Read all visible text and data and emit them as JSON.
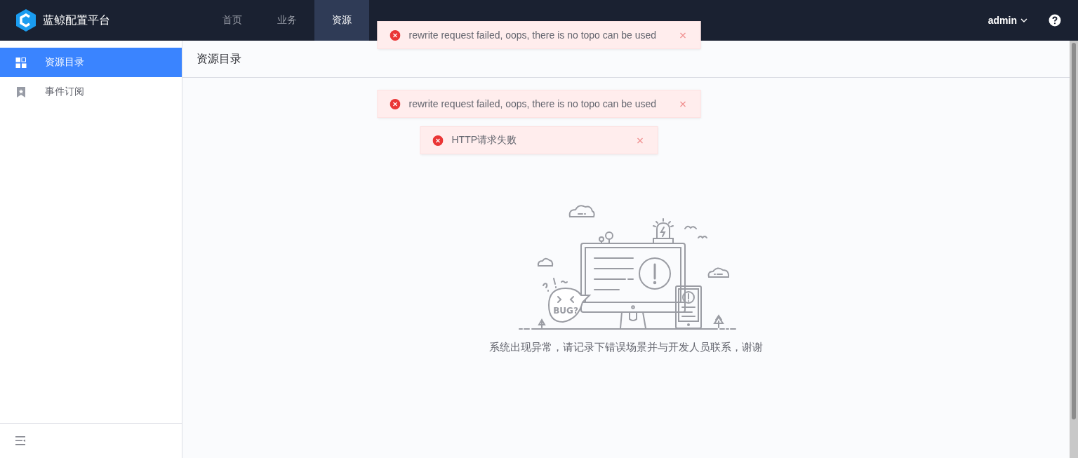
{
  "header": {
    "logo_title": "蓝鲸配置平台",
    "nav": [
      {
        "label": "首页",
        "selected": false
      },
      {
        "label": "业务",
        "selected": false
      },
      {
        "label": "资源",
        "selected": true
      }
    ],
    "user": "admin"
  },
  "sidebar": {
    "items": [
      {
        "label": "资源目录",
        "selected": true,
        "kind": "grid"
      },
      {
        "label": "事件订阅",
        "selected": false,
        "kind": "bookmark"
      }
    ]
  },
  "page": {
    "title": "资源目录",
    "illustration_label": "BUG?",
    "message": "系统出现异常，请记录下错误场景并与开发人员联系，谢谢"
  },
  "toasts": [
    {
      "kind": "error",
      "message": "rewrite request failed, oops, there is no topo can be used"
    },
    {
      "kind": "error",
      "message": "rewrite request failed, oops, there is no topo can be used"
    },
    {
      "kind": "error",
      "message": "HTTP请求失败"
    }
  ]
}
